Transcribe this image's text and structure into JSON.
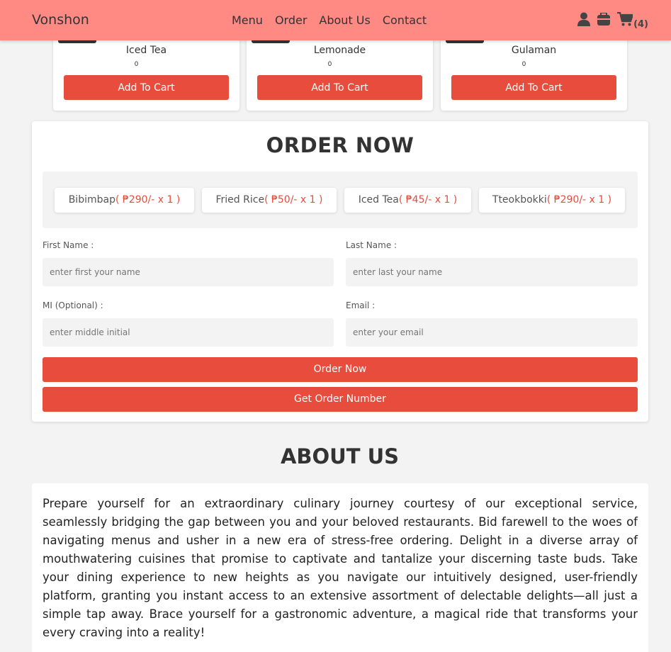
{
  "navbar": {
    "brand": "Vonshon",
    "links": [
      "Menu",
      "Order",
      "About Us",
      "Contact"
    ],
    "cart_count": "(4)"
  },
  "products": [
    {
      "name": "Iced Tea",
      "qty": "0",
      "button": "Add To Cart"
    },
    {
      "name": "Lemonade",
      "qty": "0",
      "button": "Add To Cart"
    },
    {
      "name": "Gulaman",
      "qty": "0",
      "button": "Add To Cart"
    }
  ],
  "order": {
    "title": "ORDER NOW",
    "cart_items": [
      {
        "name": "Bibimbap",
        "price": "( ₱290/- x 1 )"
      },
      {
        "name": "Fried Rice",
        "price": "( ₱50/- x 1 )"
      },
      {
        "name": "Iced Tea",
        "price": "( ₱45/- x 1 )"
      },
      {
        "name": "Tteokbokki",
        "price": "( ₱290/- x 1 )"
      }
    ],
    "fields": {
      "first_name": {
        "label": "First Name :",
        "placeholder": "enter first your name"
      },
      "last_name": {
        "label": "Last Name :",
        "placeholder": "enter last your name"
      },
      "mi": {
        "label": "MI (Optional) :",
        "placeholder": "enter middle initial"
      },
      "email": {
        "label": "Email :",
        "placeholder": "enter your email"
      }
    },
    "order_button": "Order Now",
    "order_number_button": "Get Order Number"
  },
  "about": {
    "title": "ABOUT US",
    "text": "Prepare yourself for an extraordinary culinary journey courtesy of our exceptional service, seamlessly bridging the gap between you and your beloved restaurants. Bid farewell to the woes of navigating menus and usher in a new era of stress-free ordering. Delight in a diverse array of mouthwatering cuisines that promise to captivate and tantalize your discerning taste buds. Take your dining experience to new heights as you navigate our intuitively designed, user-friendly platform, granting you instant access to an extensive assortment of delectable delights—all just a simple tap away. Brace yourself for a gastronomic adventure, a magical ride that transforms your every craving into a reality!"
  },
  "colors": {
    "navbar": "#ff8a84",
    "accent": "#e74c3c"
  },
  "icons": [
    "user-icon",
    "orders-icon",
    "cart-icon"
  ]
}
